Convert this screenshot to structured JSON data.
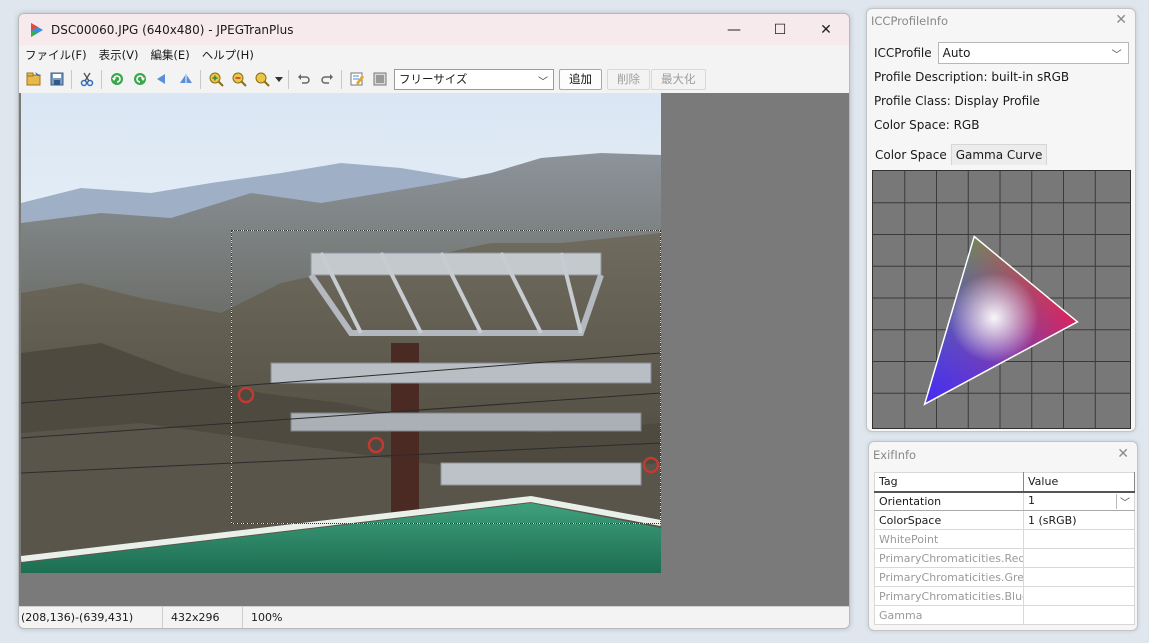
{
  "window": {
    "title": "DSC00060.JPG (640x480) - JPEGTranPlus",
    "minimize": "—",
    "maximize": "☐",
    "close": "✕"
  },
  "menu": [
    "ファイル(F)",
    "表示(V)",
    "編集(E)",
    "ヘルプ(H)"
  ],
  "toolbar": {
    "size_select": "フリーサイズ",
    "add_label": "追加",
    "delete_label": "削除",
    "maximize_label": "最大化"
  },
  "status": {
    "selection": "(208,136)-(639,431)",
    "size": "432x296",
    "zoom": "100%"
  },
  "icc_panel": {
    "title": "ICCProfileInfo",
    "profile_label": "ICCProfile",
    "profile_value": "Auto",
    "description": "Profile Description: built-in sRGB",
    "class": "Profile Class: Display Profile",
    "color_space": "Color Space: RGB",
    "tabs": [
      "Color Space",
      "Gamma Curve"
    ]
  },
  "exif_panel": {
    "title": "ExifInfo",
    "headers": [
      "Tag",
      "Value"
    ],
    "rows": [
      {
        "tag": "Orientation",
        "value": "1"
      },
      {
        "tag": "ColorSpace",
        "value": "1 (sRGB)"
      },
      {
        "tag": "WhitePoint",
        "value": ""
      },
      {
        "tag": "PrimaryChromaticities.Red",
        "value": ""
      },
      {
        "tag": "PrimaryChromaticities.Green",
        "value": ""
      },
      {
        "tag": "PrimaryChromaticities.Blue",
        "value": ""
      },
      {
        "tag": "Gamma",
        "value": ""
      }
    ]
  },
  "colors": {
    "titlebar": "#f7eaec",
    "canvas": "#7a7a7a",
    "gamut_bg": "#787878"
  }
}
